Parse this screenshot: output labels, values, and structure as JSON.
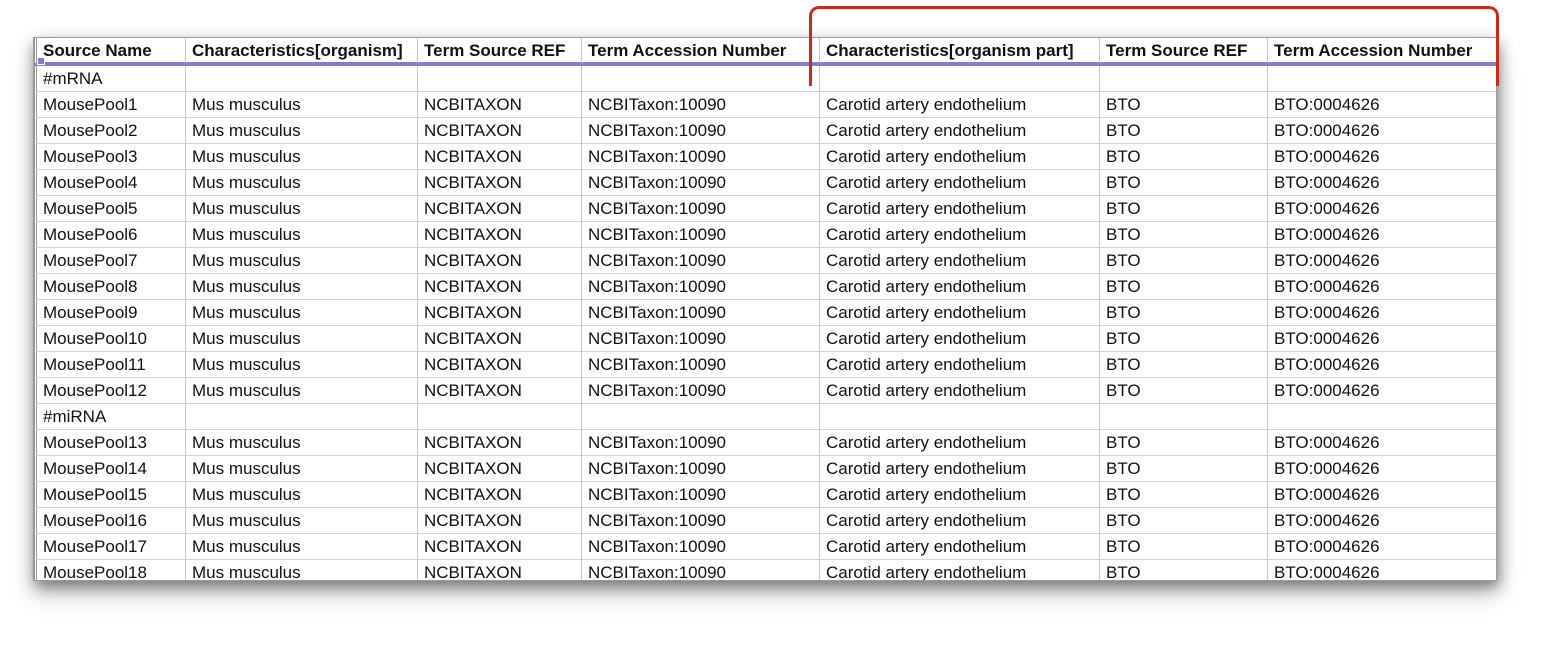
{
  "columns": [
    "Source Name",
    "Characteristics[organism]",
    "Term Source REF",
    "Term Accession Number",
    "Characteristics[organism part]",
    "Term Source REF",
    "Term Accession Number"
  ],
  "rows": [
    [
      "#mRNA",
      "",
      "",
      "",
      "",
      "",
      ""
    ],
    [
      "MousePool1",
      "Mus musculus",
      "NCBITAXON",
      "NCBITaxon:10090",
      "Carotid artery endothelium",
      "BTO",
      "BTO:0004626"
    ],
    [
      "MousePool2",
      "Mus musculus",
      "NCBITAXON",
      "NCBITaxon:10090",
      "Carotid artery endothelium",
      "BTO",
      "BTO:0004626"
    ],
    [
      "MousePool3",
      "Mus musculus",
      "NCBITAXON",
      "NCBITaxon:10090",
      "Carotid artery endothelium",
      "BTO",
      "BTO:0004626"
    ],
    [
      "MousePool4",
      "Mus musculus",
      "NCBITAXON",
      "NCBITaxon:10090",
      "Carotid artery endothelium",
      "BTO",
      "BTO:0004626"
    ],
    [
      "MousePool5",
      "Mus musculus",
      "NCBITAXON",
      "NCBITaxon:10090",
      "Carotid artery endothelium",
      "BTO",
      "BTO:0004626"
    ],
    [
      "MousePool6",
      "Mus musculus",
      "NCBITAXON",
      "NCBITaxon:10090",
      "Carotid artery endothelium",
      "BTO",
      "BTO:0004626"
    ],
    [
      "MousePool7",
      "Mus musculus",
      "NCBITAXON",
      "NCBITaxon:10090",
      "Carotid artery endothelium",
      "BTO",
      "BTO:0004626"
    ],
    [
      "MousePool8",
      "Mus musculus",
      "NCBITAXON",
      "NCBITaxon:10090",
      "Carotid artery endothelium",
      "BTO",
      "BTO:0004626"
    ],
    [
      "MousePool9",
      "Mus musculus",
      "NCBITAXON",
      "NCBITaxon:10090",
      "Carotid artery endothelium",
      "BTO",
      "BTO:0004626"
    ],
    [
      "MousePool10",
      "Mus musculus",
      "NCBITAXON",
      "NCBITaxon:10090",
      "Carotid artery endothelium",
      "BTO",
      "BTO:0004626"
    ],
    [
      "MousePool11",
      "Mus musculus",
      "NCBITAXON",
      "NCBITaxon:10090",
      "Carotid artery endothelium",
      "BTO",
      "BTO:0004626"
    ],
    [
      "MousePool12",
      "Mus musculus",
      "NCBITAXON",
      "NCBITaxon:10090",
      "Carotid artery endothelium",
      "BTO",
      "BTO:0004626"
    ],
    [
      "#miRNA",
      "",
      "",
      "",
      "",
      "",
      ""
    ],
    [
      "MousePool13",
      "Mus musculus",
      "NCBITAXON",
      "NCBITaxon:10090",
      "Carotid artery endothelium",
      "BTO",
      "BTO:0004626"
    ],
    [
      "MousePool14",
      "Mus musculus",
      "NCBITAXON",
      "NCBITaxon:10090",
      "Carotid artery endothelium",
      "BTO",
      "BTO:0004626"
    ],
    [
      "MousePool15",
      "Mus musculus",
      "NCBITAXON",
      "NCBITaxon:10090",
      "Carotid artery endothelium",
      "BTO",
      "BTO:0004626"
    ],
    [
      "MousePool16",
      "Mus musculus",
      "NCBITAXON",
      "NCBITaxon:10090",
      "Carotid artery endothelium",
      "BTO",
      "BTO:0004626"
    ],
    [
      "MousePool17",
      "Mus musculus",
      "NCBITAXON",
      "NCBITaxon:10090",
      "Carotid artery endothelium",
      "BTO",
      "BTO:0004626"
    ],
    [
      "MousePool18",
      "Mus musculus",
      "NCBITAXON",
      "NCBITaxon:10090",
      "Carotid artery endothelium",
      "BTO",
      "BTO:0004626"
    ]
  ],
  "colors": {
    "highlight_bracket": "#cc2a1a",
    "header_underline": "#8a7ad0"
  }
}
